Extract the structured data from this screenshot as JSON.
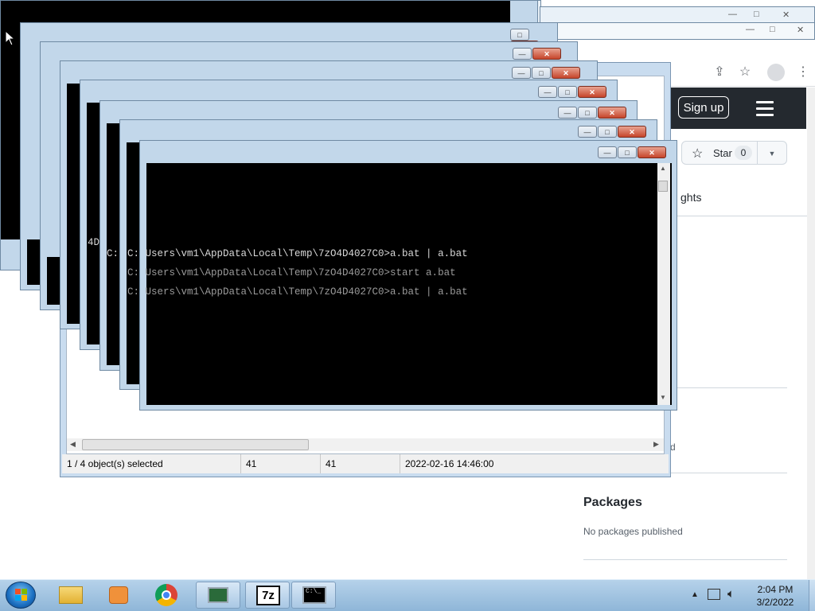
{
  "browser": {
    "signup_label": "Sign up",
    "star_label": "Star",
    "star_count": "0",
    "insights_partial": "ghts",
    "partial_d": "d",
    "packages_title": "Packages",
    "packages_text": "No packages published"
  },
  "console": {
    "line1": "C: Users\\vm1\\AppData\\Local\\Temp\\7zO4D4027C0>a.bat | a.bat",
    "line2": "C: Users\\vm1\\AppData\\Local\\Temp\\7zO4D4027C0>start a.bat",
    "line3": "C: Users\\vm1\\AppData\\Local\\Temp\\7zO4D4027C0>a.bat | a.bat",
    "side_4d": "4D",
    "side_c": "C:"
  },
  "explorer": {
    "status": {
      "selected": "1 / 4 object(s) selected",
      "size": "41",
      "packed": "41",
      "modified": "2022-02-16 14:46:00"
    }
  },
  "taskbar": {
    "time": "2:04 PM",
    "date": "3/2/2022",
    "zip_label": "7z",
    "cmd_label": "C:\\_"
  },
  "colors": {
    "taskbar": "#9fc2e0",
    "github_header": "#24292f",
    "console_bg": "#000000",
    "close_button": "#c6452b"
  }
}
